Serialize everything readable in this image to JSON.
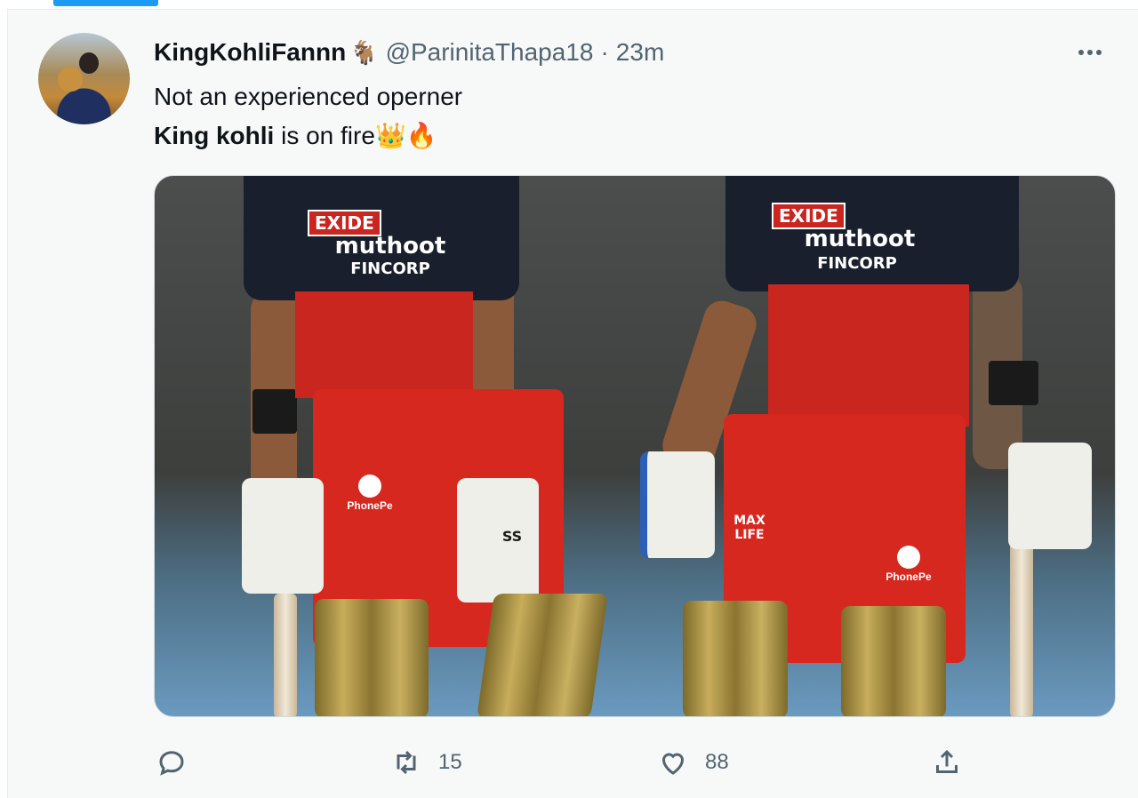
{
  "tweet": {
    "display_name": "KingKohliFannn",
    "name_emoji": "🐐",
    "handle": "@ParinitaThapa18",
    "separator": "·",
    "time": "23m",
    "text_line1": "Not an experienced operner",
    "text_line2_bold": "King kohli",
    "text_line2_rest": " is on fire",
    "text_line2_emoji": "👑🔥"
  },
  "media": {
    "player_left": {
      "exide": "EXIDE",
      "sponsor": "muthoot",
      "sponsor_sub": "FINCORP",
      "phonepe": "PhonePe",
      "glove_brand": "SS"
    },
    "player_right": {
      "exide": "EXIDE",
      "sponsor": "muthoot",
      "sponsor_sub": "FINCORP",
      "phonepe": "PhonePe",
      "hip_text": "MAX LIFE"
    }
  },
  "actions": {
    "reply_icon": "reply-icon",
    "retweet_count": "15",
    "like_count": "88",
    "share_icon": "share-icon"
  },
  "colors": {
    "accent": "#1d9bf0",
    "text_primary": "#0f1419",
    "text_secondary": "#536471",
    "background": "#f7f9f9",
    "jersey_red": "#c8261f"
  }
}
